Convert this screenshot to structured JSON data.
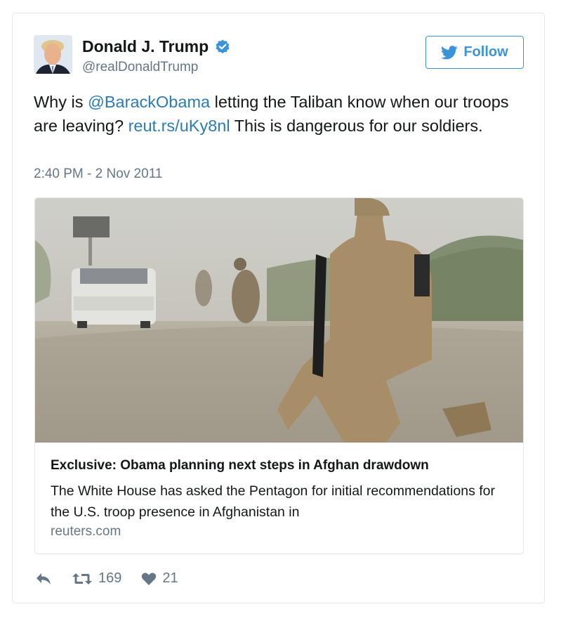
{
  "user": {
    "name": "Donald J. Trump",
    "handle": "@realDonaldTrump",
    "verified": true,
    "avatar_icon": "profile-photo"
  },
  "follow_button": {
    "label": "Follow",
    "icon": "twitter-bird-icon",
    "color": "#3b94d9"
  },
  "tweet": {
    "text_part1": "Why is ",
    "mention": "@BarackObama",
    "text_part2": " letting the Taliban know when our troops are leaving? ",
    "link": "reut.rs/uKy8nl",
    "text_part3": " This is dangerous for our soldiers.",
    "timestamp": "2:40 PM - 2 Nov 2011",
    "link_color": "#2b7bb9"
  },
  "card": {
    "image_icon": "soldiers-photo",
    "title": "Exclusive: Obama planning next steps in Afghan drawdown",
    "description": "The White House has asked the Pentagon for initial recommendations for the U.S. troop presence in Afghanistan in",
    "domain": "reuters.com"
  },
  "actions": {
    "reply_icon": "reply-icon",
    "retweet_icon": "retweet-icon",
    "retweet_count": "169",
    "like_icon": "heart-icon",
    "like_count": "21"
  }
}
